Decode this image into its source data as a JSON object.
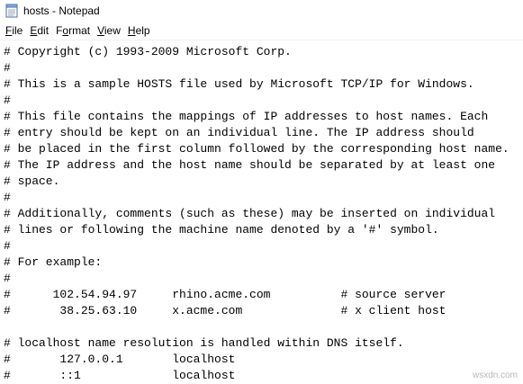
{
  "window": {
    "title": "hosts - Notepad",
    "app_icon": "notepad-icon"
  },
  "menubar": {
    "items": [
      {
        "mnemonic": "F",
        "rest": "ile"
      },
      {
        "mnemonic": "E",
        "rest": "dit"
      },
      {
        "mnemonic": "o",
        "prefix": "F",
        "rest": "rmat"
      },
      {
        "mnemonic": "V",
        "rest": "iew"
      },
      {
        "mnemonic": "H",
        "rest": "elp"
      }
    ]
  },
  "editor": {
    "content": "# Copyright (c) 1993-2009 Microsoft Corp.\n#\n# This is a sample HOSTS file used by Microsoft TCP/IP for Windows.\n#\n# This file contains the mappings of IP addresses to host names. Each\n# entry should be kept on an individual line. The IP address should\n# be placed in the first column followed by the corresponding host name.\n# The IP address and the host name should be separated by at least one\n# space.\n#\n# Additionally, comments (such as these) may be inserted on individual\n# lines or following the machine name denoted by a '#' symbol.\n#\n# For example:\n#\n#      102.54.94.97     rhino.acme.com          # source server\n#       38.25.63.10     x.acme.com              # x client host\n\n# localhost name resolution is handled within DNS itself.\n#\t127.0.0.1       localhost\n#\t::1             localhost"
  },
  "watermark": "wsxdn.com"
}
